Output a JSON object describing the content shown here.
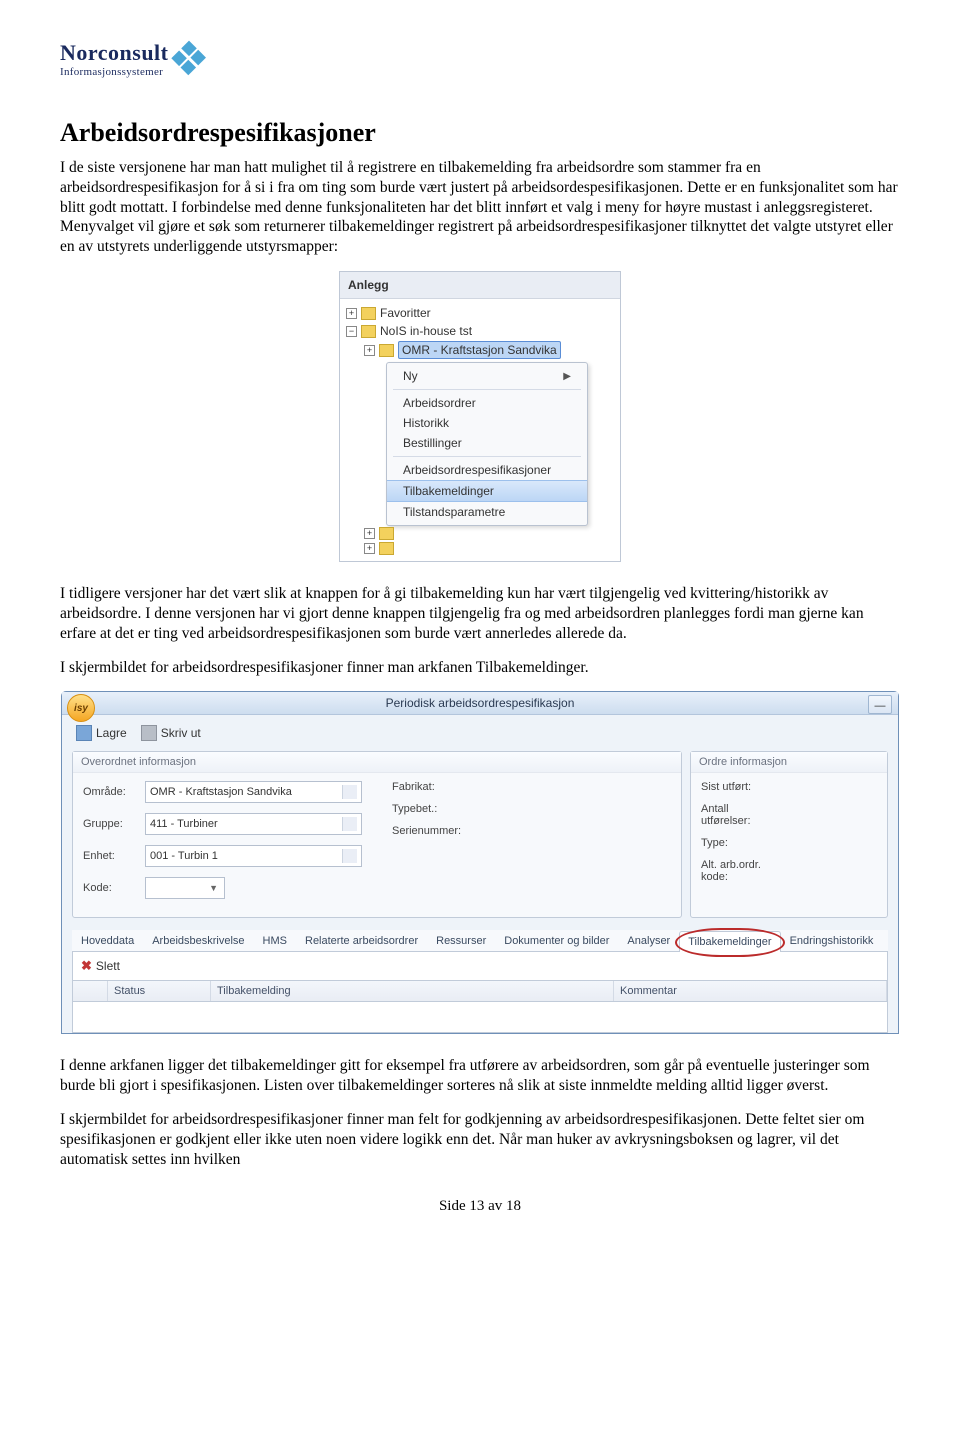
{
  "logo": {
    "line1": "Norconsult",
    "line2": "Informasjonssystemer"
  },
  "heading": "Arbeidsordrespesifikasjoner",
  "para1": "I de siste versjonene har man hatt mulighet til å registrere en tilbakemelding fra arbeidsordre som stammer fra en arbeidsordrespesifikasjon for å si i fra om ting som burde vært justert på arbeidsordespesifikasjonen. Dette er en funksjonalitet som har blitt godt mottatt. I forbindelse med denne funksjonaliteten har det blitt innført et valg i meny for høyre mustast i anleggsregisteret. Menyvalget vil gjøre et søk som returnerer tilbakemeldinger registrert på arbeidsordrespesifikasjoner tilknyttet det valgte utstyret eller en av utstyrets underliggende utstyrsmapper:",
  "ss1": {
    "header": "Anlegg",
    "tree_favoritter": "Favoritter",
    "tree_nois": "NoIS in-house tst",
    "tree_selected": "OMR - Kraftstasjon Sandvika",
    "menu_ny": "Ny",
    "menu_arbeidsordrer": "Arbeidsordrer",
    "menu_historikk": "Historikk",
    "menu_bestillinger": "Bestillinger",
    "menu_spes": "Arbeidsordrespesifikasjoner",
    "menu_tilbakemeldinger": "Tilbakemeldinger",
    "menu_tilstand": "Tilstandsparametre"
  },
  "para2": "I tidligere versjoner har det vært slik at knappen for å gi tilbakemelding kun har vært tilgjengelig ved kvittering/historikk av arbeidsordre. I denne versjonen har vi gjort denne knappen tilgjengelig fra og med arbeidsordren planlegges fordi man gjerne kan erfare at det er ting ved arbeidsordrespesifikasjonen som burde vært annerledes allerede da.",
  "para3": "I skjermbildet for arbeidsordrespesifikasjoner finner man arkfanen Tilbakemeldinger.",
  "ss2": {
    "orb": "isy",
    "title": "Periodisk arbeidsordrespesifikasjon",
    "tb_lagre": "Lagre",
    "tb_skriv": "Skriv ut",
    "panel_left_head": "Overordnet informasjon",
    "panel_right_head": "Ordre informasjon",
    "f_omrade": "Område:",
    "v_omrade": "OMR - Kraftstasjon Sandvika",
    "f_gruppe": "Gruppe:",
    "v_gruppe": "411 - Turbiner",
    "f_enhet": "Enhet:",
    "v_enhet": "001 - Turbin 1",
    "f_kode": "Kode:",
    "f_fabrikat": "Fabrikat:",
    "f_typebet": "Typebet.:",
    "f_serienr": "Serienummer:",
    "f_sist": "Sist utført:",
    "f_antall": "Antall utførelser:",
    "f_type": "Type:",
    "f_alt": "Alt. arb.ordr. kode:",
    "tab_hoved": "Hoveddata",
    "tab_arb": "Arbeidsbeskrivelse",
    "tab_hms": "HMS",
    "tab_rel": "Relaterte arbeidsordrer",
    "tab_res": "Ressurser",
    "tab_dok": "Dokumenter og bilder",
    "tab_ana": "Analyser",
    "tab_tbm": "Tilbakemeldinger",
    "tab_end": "Endringshistorikk",
    "slett": "Slett",
    "col_status": "Status",
    "col_tbm": "Tilbakemelding",
    "col_kom": "Kommentar"
  },
  "para4": "I denne arkfanen ligger det tilbakemeldinger gitt for eksempel fra utførere av arbeidsordren, som går på eventuelle justeringer som burde bli gjort i spesifikasjonen. Listen over tilbakemeldinger sorteres nå slik at siste innmeldte melding alltid ligger øverst.",
  "para5": "I skjermbildet for arbeidsordrespesifikasjoner finner man felt for godkjenning av arbeidsordrespesifikasjonen. Dette feltet sier om spesifikasjonen er godkjent eller ikke uten noen videre logikk enn det. Når man huker av avkrysningsboksen og lagrer, vil det automatisk settes inn hvilken",
  "footer": "Side 13 av 18"
}
